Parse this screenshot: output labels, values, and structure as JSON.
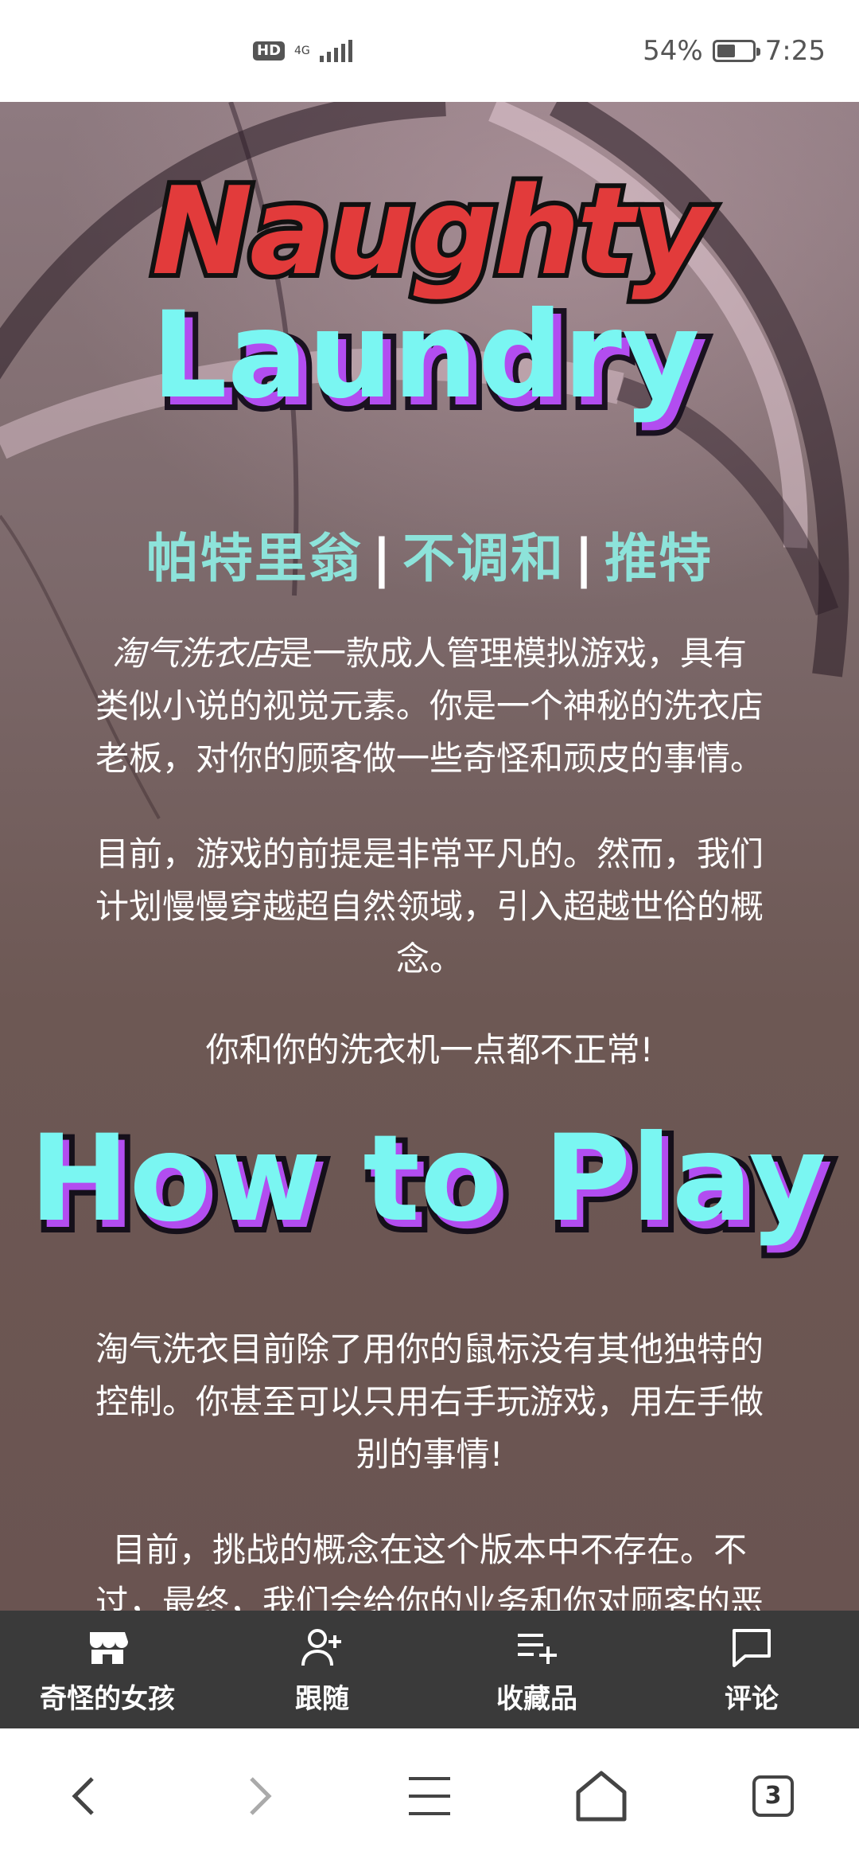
{
  "status_bar": {
    "hd": "HD",
    "network": "4G",
    "battery_percent": "54%",
    "battery_level": 0.54,
    "time": "7:25"
  },
  "game_page": {
    "logo": {
      "line1": "Naughty",
      "line2": "Laundry"
    },
    "links": [
      "帕特里翁",
      "不调和",
      "推特"
    ],
    "link_separator": "|",
    "intro": {
      "title_italic": "淘气洗衣店",
      "text_l1_rest": "是一款成人管理模拟游戏，具有",
      "text_l2": "类似小说的视觉元素。你是一个神秘的洗衣店",
      "text_l3": "老板，对你的顾客做一些奇怪和顽皮的事情。"
    },
    "premise": {
      "l1": "目前，游戏的前提是非常平凡的。然而，我们",
      "l2": "计划慢慢穿越超自然领域，引入超越世俗的概",
      "l3": "念。"
    },
    "tagline": "你和你的洗衣机一点都不正常!",
    "how_to_play_banner": "How to Play",
    "controls": {
      "l1": "淘气洗衣目前除了用你的鼠标没有其他独特的",
      "l2": "控制。你甚至可以只用右手玩游戏，用左手做",
      "l3": "别的事情!"
    },
    "challenge": {
      "l1": "目前，挑战的概念在这个版本中不存在。不",
      "l2": "过，最终，我们会给你的业务和你对顾客的恶"
    }
  },
  "action_bar": {
    "items": [
      {
        "label": "奇怪的女孩",
        "icon": "store-icon"
      },
      {
        "label": "跟随",
        "icon": "follow-user-icon"
      },
      {
        "label": "收藏品",
        "icon": "add-to-collection-icon"
      },
      {
        "label": "评论",
        "icon": "comment-icon"
      }
    ]
  },
  "browser_nav": {
    "tabs_count": "3"
  },
  "colors": {
    "logo_red": "#e23b3b",
    "logo_cyan": "#7af6f2",
    "logo_purple": "#b24df0",
    "link_teal": "#8de3da",
    "action_bar_bg": "#3a3a3a"
  }
}
